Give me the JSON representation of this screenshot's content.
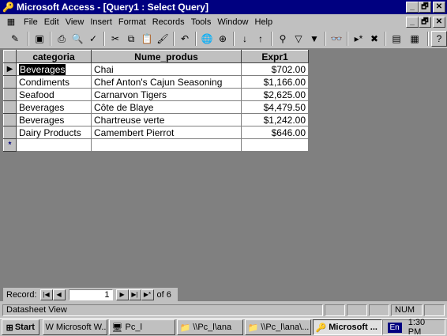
{
  "window": {
    "title": "Microsoft Access - [Query1 : Select Query]",
    "minimize": "_",
    "restore": "🗗",
    "close": "✕"
  },
  "menu": {
    "items": [
      {
        "label": "File"
      },
      {
        "label": "Edit"
      },
      {
        "label": "View"
      },
      {
        "label": "Insert"
      },
      {
        "label": "Format"
      },
      {
        "label": "Records"
      },
      {
        "label": "Tools"
      },
      {
        "label": "Window"
      },
      {
        "label": "Help"
      }
    ]
  },
  "toolbar": {
    "icons": [
      {
        "name": "view-icon",
        "glyph": "✎"
      },
      {
        "name": "save-icon",
        "glyph": "▣"
      },
      {
        "name": "print-icon",
        "glyph": "⎙"
      },
      {
        "name": "print-preview-icon",
        "glyph": "🔍"
      },
      {
        "name": "spelling-icon",
        "glyph": "✓"
      },
      {
        "name": "cut-icon",
        "glyph": "✂"
      },
      {
        "name": "copy-icon",
        "glyph": "⧉"
      },
      {
        "name": "paste-icon",
        "glyph": "📋"
      },
      {
        "name": "format-painter-icon",
        "glyph": "🖌"
      },
      {
        "name": "undo-icon",
        "glyph": "↶"
      },
      {
        "name": "insert-hyperlink-icon",
        "glyph": "🌐"
      },
      {
        "name": "web-toolbar-icon",
        "glyph": "⊕"
      },
      {
        "name": "sort-ascending-icon",
        "glyph": "↓"
      },
      {
        "name": "sort-descending-icon",
        "glyph": "↑"
      },
      {
        "name": "filter-by-selection-icon",
        "glyph": "⚲"
      },
      {
        "name": "filter-by-form-icon",
        "glyph": "▽"
      },
      {
        "name": "apply-filter-icon",
        "glyph": "▼"
      },
      {
        "name": "find-icon",
        "glyph": "👓"
      },
      {
        "name": "new-record-icon",
        "glyph": "▸*"
      },
      {
        "name": "delete-record-icon",
        "glyph": "✖"
      },
      {
        "name": "database-window-icon",
        "glyph": "▤"
      },
      {
        "name": "new-object-icon",
        "glyph": "▦"
      },
      {
        "name": "help-icon",
        "glyph": "?"
      }
    ]
  },
  "datasheet": {
    "columns": [
      "categoria",
      "Nume_produs",
      "Expr1"
    ],
    "rows": [
      [
        "Beverages",
        "Chai",
        "$702.00"
      ],
      [
        "Condiments",
        "Chef Anton's Cajun Seasoning",
        "$1,166.00"
      ],
      [
        "Seafood",
        "Carnarvon Tigers",
        "$2,625.00"
      ],
      [
        "Beverages",
        "Côte de Blaye",
        "$4,479.50"
      ],
      [
        "Beverages",
        "Chartreuse verte",
        "$1,242.00"
      ],
      [
        "Dairy Products",
        "Camembert Pierrot",
        "$646.00"
      ]
    ],
    "current_row_marker": "▶",
    "new_row_marker": "*"
  },
  "navigator": {
    "label": "Record:",
    "first": "|◀",
    "prev": "◀",
    "current": "1",
    "next": "▶",
    "last": "▶|",
    "new": "▶*",
    "of_text": "of  6"
  },
  "statusbar": {
    "text": "Datasheet View",
    "num": "NUM"
  },
  "taskbar": {
    "start": "Start",
    "tasks": [
      {
        "label": "Microsoft W...",
        "icon": "W",
        "active": false
      },
      {
        "label": "Pc_l",
        "icon": "🖥",
        "active": false
      },
      {
        "label": "\\\\Pc_l\\ana",
        "icon": "📁",
        "active": false
      },
      {
        "label": "\\\\Pc_l\\ana\\...",
        "icon": "📁",
        "active": false
      },
      {
        "label": "Microsoft ...",
        "icon": "🔑",
        "active": true
      }
    ],
    "lang": "En",
    "clock": "1:30 PM"
  }
}
